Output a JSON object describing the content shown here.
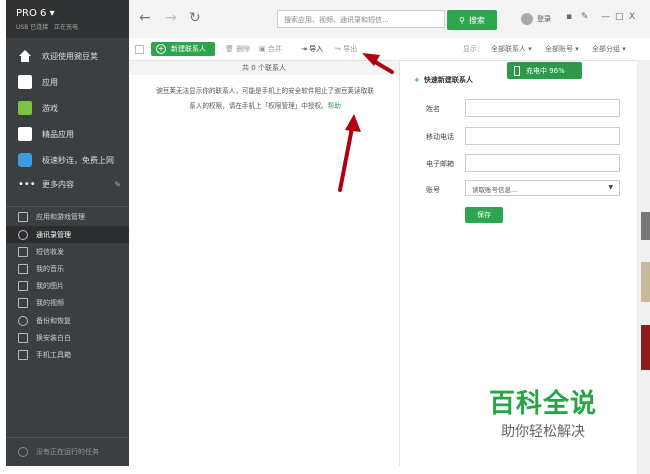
{
  "sidebar": {
    "brand": "PRO 6",
    "sub_status": "USB 已连接",
    "sub_status2": "正在充电",
    "nav": [
      {
        "label": "欢迎使用豌豆荚"
      },
      {
        "label": "应用"
      },
      {
        "label": "游戏"
      },
      {
        "label": "精品应用"
      },
      {
        "label": "极速秒连，免费上网"
      },
      {
        "label": "更多内容"
      }
    ],
    "sub": [
      {
        "label": "应用和游戏管理"
      },
      {
        "label": "通讯录管理"
      },
      {
        "label": "短信收发"
      },
      {
        "label": "我的音乐"
      },
      {
        "label": "我的图片"
      },
      {
        "label": "我的视频"
      },
      {
        "label": "备份和恢复"
      },
      {
        "label": "换安装白白"
      },
      {
        "label": "手机工具箱"
      }
    ],
    "bottom": "没有正在运行的任务"
  },
  "topbar": {
    "search_placeholder": "搜索应用、视频、通讯录和短信...",
    "search_button": "搜索",
    "login": "登录"
  },
  "contacts_toolbar": {
    "new_contact": "新建联系人",
    "delete": "删除",
    "merge": "合并",
    "import": "导入",
    "export": "导出",
    "show_label": "显示：",
    "filter_all": "全部联系人",
    "filter_account": "全部账号",
    "filter_group": "全部分组"
  },
  "list": {
    "count_text": "共 0 个联系人",
    "message_line1": "豌豆荚无法显示你的联系人，可能是手机上的安全软件阻止了豌豆荚读取联",
    "message_line2": "系人的权限，请在手机上「权限管理」中授权。",
    "help": "帮助"
  },
  "quick_add": {
    "title": "快速新建联系人",
    "name_label": "姓名",
    "phone_label": "移动电话",
    "email_label": "电子邮箱",
    "account_label": "账号",
    "account_value": "读取账号信息...",
    "save": "保存"
  },
  "battery": {
    "text": "充电中 96%"
  },
  "watermark": {
    "line1": "百科全说",
    "line2": "助你轻松解决"
  }
}
